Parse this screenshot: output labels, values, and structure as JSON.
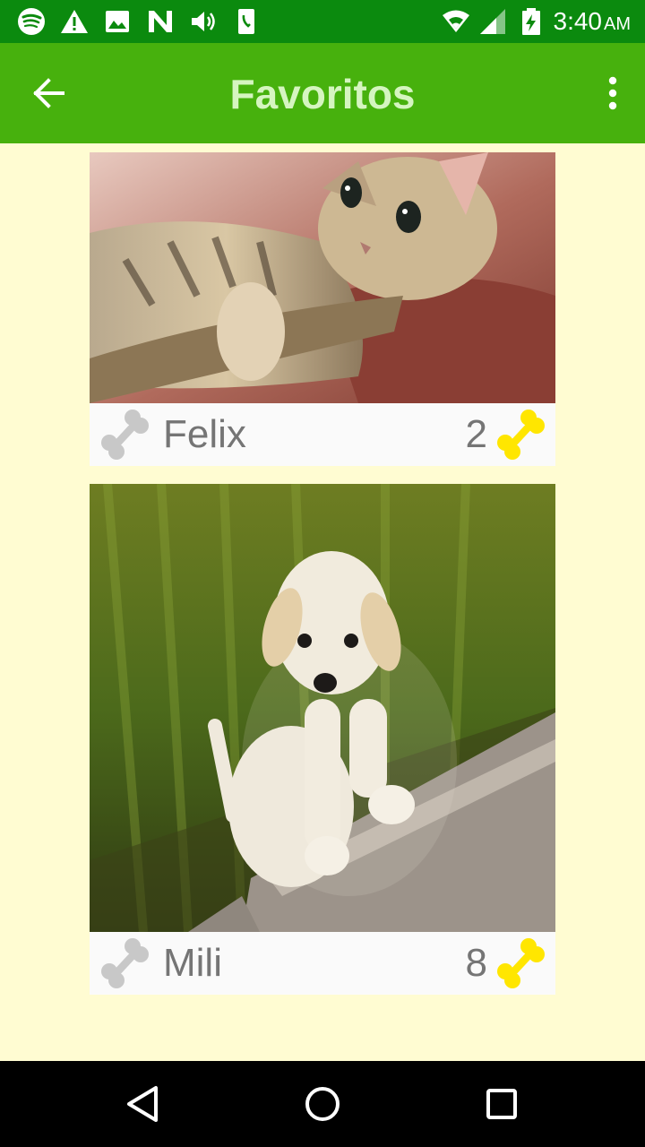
{
  "status_bar": {
    "time": "3:40",
    "ampm": "AM",
    "icons": [
      "spotify-icon",
      "warning-icon",
      "image-icon",
      "n-app-icon",
      "volume-icon",
      "phone-app-icon",
      "wifi-icon",
      "signal-icon",
      "battery-icon"
    ]
  },
  "app_bar": {
    "title": "Favoritos",
    "back_icon": "arrow-back-icon",
    "menu_icon": "more-vert-icon",
    "color": "#47B10D",
    "title_color": "#D5F5C0"
  },
  "pets": [
    {
      "name": "Felix",
      "likes": "2",
      "photo": "tabby kitten lying in a basket"
    },
    {
      "name": "Mili",
      "likes": "8",
      "photo": "white puppy sitting on grass by a stone edge"
    }
  ],
  "colors": {
    "background": "#FFFCD2",
    "bone_liked": "#FFE600",
    "bone_unliked": "#C8C8C8"
  },
  "nav_bar": {
    "icons": [
      "back-triangle-icon",
      "home-circle-icon",
      "recents-square-icon"
    ]
  }
}
